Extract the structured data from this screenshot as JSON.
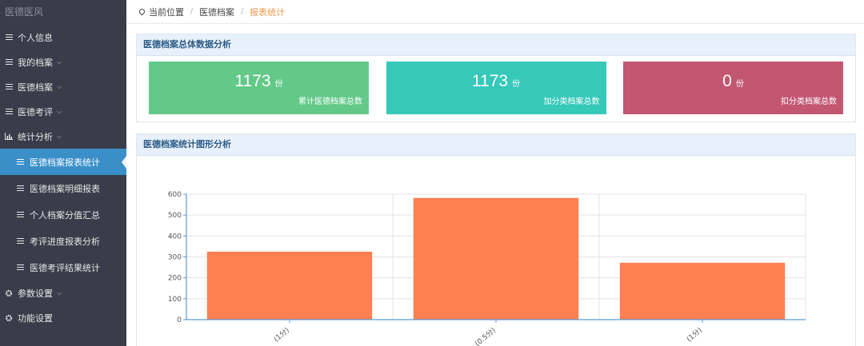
{
  "sidebar": {
    "brand": "医德医风",
    "items": [
      {
        "label": "个人信息"
      },
      {
        "label": "我的档案"
      },
      {
        "label": "医德档案"
      },
      {
        "label": "医德考评"
      },
      {
        "label": "统计分析"
      }
    ],
    "sub_items": [
      {
        "label": "医德档案报表统计"
      },
      {
        "label": "医德档案明细报表"
      },
      {
        "label": "个人档案分值汇总"
      },
      {
        "label": "考评进度报表分析"
      },
      {
        "label": "医德考评结果统计"
      }
    ],
    "bottom_items": [
      {
        "label": "参数设置"
      },
      {
        "label": "功能设置"
      }
    ]
  },
  "breadcrumb": {
    "prefix": "当前位置",
    "level1": "医德档案",
    "current": "报表统计"
  },
  "summary": {
    "title": "医德档案总体数据分析",
    "cards": [
      {
        "value": "1173",
        "unit": "份",
        "caption": "累计医德档案总数",
        "color": "#62c989"
      },
      {
        "value": "1173",
        "unit": "份",
        "caption": "加分类档案总数",
        "color": "#36c8b9"
      },
      {
        "value": "0",
        "unit": "份",
        "caption": "扣分类档案总数",
        "color": "#c35772"
      }
    ]
  },
  "chart_panel": {
    "title": "医德档案统计图形分析"
  },
  "chart_data": {
    "type": "bar",
    "categories": [
      "(1分)",
      "(0.5分)",
      "(1分)"
    ],
    "values": [
      325,
      582,
      272
    ],
    "ylim": [
      0,
      600
    ],
    "yticks": [
      "0",
      "100",
      "200",
      "300",
      "400",
      "500",
      "600"
    ],
    "grid": true,
    "bar_color": "#ff7f50"
  }
}
